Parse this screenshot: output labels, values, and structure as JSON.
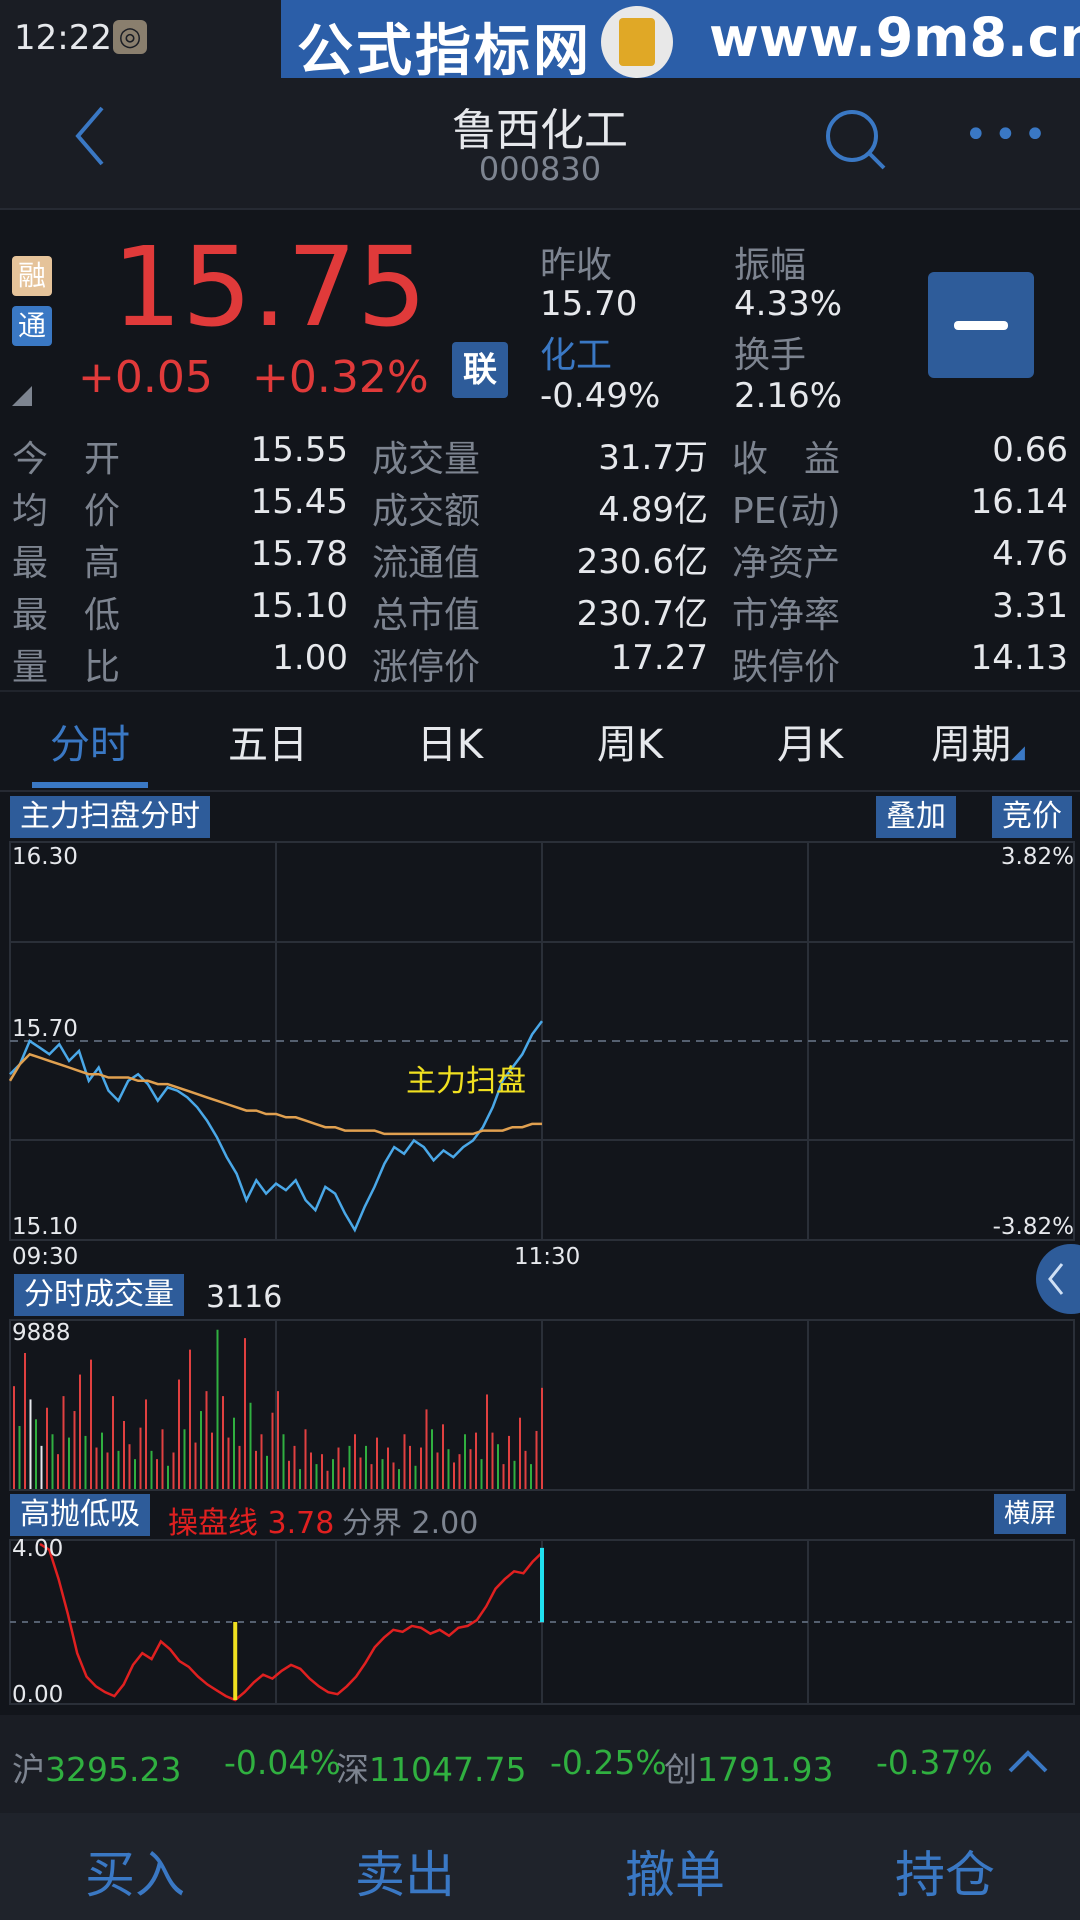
{
  "status": {
    "time": "12:22"
  },
  "banner": {
    "left_text": "公式指标网",
    "right_text": "www.9m8.cn"
  },
  "header": {
    "title": "鲁西化工",
    "code": "000830"
  },
  "quote": {
    "tags": [
      "融",
      "通"
    ],
    "price": "15.75",
    "change": "+0.05",
    "change_pct": "+0.32%",
    "lian": "联",
    "prev_close_label": "昨收",
    "prev_close": "15.70",
    "amplitude_label": "振幅",
    "amplitude": "4.33%",
    "sector_label": "化工",
    "sector_pct": "-0.49%",
    "turnover_label": "换手",
    "turnover": "2.16%"
  },
  "stats": [
    {
      "l1": "今",
      "l2": "开",
      "v1": "15.55",
      "m": "成交量",
      "v2": "31.7万",
      "r1": "收",
      "r2": "益",
      "v3": "0.66"
    },
    {
      "l1": "均",
      "l2": "价",
      "v1": "15.45",
      "m": "成交额",
      "v2": "4.89亿",
      "r1": "PE(动)",
      "r2": "",
      "v3": "16.14"
    },
    {
      "l1": "最",
      "l2": "高",
      "v1": "15.78",
      "m": "流通值",
      "v2": "230.6亿",
      "r1": "净资产",
      "r2": "",
      "v3": "4.76"
    },
    {
      "l1": "最",
      "l2": "低",
      "v1": "15.10",
      "m": "总市值",
      "v2": "230.7亿",
      "r1": "市净率",
      "r2": "",
      "v3": "3.31"
    },
    {
      "l1": "量",
      "l2": "比",
      "v1": "1.00",
      "m": "涨停价",
      "v2": "17.27",
      "r1": "跌停价",
      "r2": "",
      "v3": "14.13"
    }
  ],
  "tabs": [
    "分时",
    "五日",
    "日K",
    "周K",
    "月K",
    "周期"
  ],
  "chart1": {
    "label": "主力扫盘分时",
    "btn_overlay": "叠加",
    "btn_auction": "竞价",
    "y_top": "16.30",
    "y_mid": "15.70",
    "y_bot": "15.10",
    "pct_top": "3.82%",
    "pct_bot": "-3.82%",
    "t_start": "09:30",
    "t_mid": "11:30",
    "annotation": "主力扫盘",
    "colors": {
      "price": "#4aa8e8",
      "avg": "#e0a050",
      "annotation": "#f0e020"
    }
  },
  "chart2": {
    "label": "分时成交量",
    "value": "3116",
    "y_top": "9888"
  },
  "chart3": {
    "label": "高抛低吸",
    "line_label": "操盘线",
    "line_value": "3.78",
    "div_label": "分界",
    "div_value": "2.00",
    "btn_landscape": "横屏",
    "y_top": "4.00",
    "y_bot": "0.00",
    "colors": {
      "line": "#e02020",
      "low_marker": "#f0e020",
      "high_marker": "#20e0f0"
    }
  },
  "indices": [
    {
      "name": "沪",
      "value": "3295.23",
      "pct": "-0.04%"
    },
    {
      "name": "深",
      "value": "11047.75",
      "pct": "-0.25%"
    },
    {
      "name": "创",
      "value": "1791.93",
      "pct": "-0.37%"
    }
  ],
  "bottom": [
    "买入",
    "卖出",
    "撤单",
    "持仓"
  ],
  "chart_data": [
    {
      "type": "line",
      "title": "主力扫盘分时",
      "ylim": [
        15.1,
        16.3
      ],
      "x_labels": [
        "09:30",
        "11:30"
      ],
      "series": [
        {
          "values": [
            15.6,
            15.63,
            15.7,
            15.68,
            15.66,
            15.69,
            15.64,
            15.67,
            15.58,
            15.62,
            15.55,
            15.52,
            15.58,
            15.6,
            15.57,
            15.52,
            15.56,
            15.55,
            15.53,
            15.5,
            15.46,
            15.41,
            15.35,
            15.3,
            15.22,
            15.28,
            15.24,
            15.27,
            15.25,
            15.28,
            15.22,
            15.19,
            15.26,
            15.24,
            15.18,
            15.13,
            15.2,
            15.26,
            15.33,
            15.38,
            15.36,
            15.4,
            15.38,
            15.34,
            15.37,
            15.35,
            15.38,
            15.4,
            15.44,
            15.5,
            15.58,
            15.62,
            15.66,
            15.72,
            15.76
          ]
        },
        {
          "values": [
            15.58,
            15.63,
            15.66,
            15.65,
            15.64,
            15.63,
            15.62,
            15.61,
            15.6,
            15.6,
            15.59,
            15.59,
            15.59,
            15.58,
            15.58,
            15.57,
            15.57,
            15.56,
            15.55,
            15.54,
            15.53,
            15.52,
            15.51,
            15.5,
            15.49,
            15.49,
            15.48,
            15.48,
            15.47,
            15.47,
            15.46,
            15.45,
            15.44,
            15.44,
            15.43,
            15.43,
            15.43,
            15.43,
            15.42,
            15.42,
            15.42,
            15.42,
            15.42,
            15.42,
            15.42,
            15.42,
            15.42,
            15.42,
            15.43,
            15.43,
            15.43,
            15.44,
            15.44,
            15.45,
            15.45
          ]
        }
      ]
    },
    {
      "type": "bar",
      "title": "分时成交量",
      "ylim": [
        0,
        9888
      ],
      "values": [
        6200,
        3800,
        8200,
        5400,
        4200,
        2600,
        4900,
        3300,
        2100,
        5600,
        3100,
        4700,
        6900,
        3200,
        7800,
        2500,
        3400,
        2200,
        5600,
        2300,
        4100,
        2700,
        1800,
        3700,
        5400,
        2300,
        1800,
        3600,
        1400,
        2200,
        6600,
        3600,
        8400,
        2800,
        4700,
        5900,
        3400,
        9600,
        5600,
        3100,
        4300,
        2600,
        9100,
        5200,
        2300,
        3300,
        2000,
        4600,
        5900,
        3300,
        1700,
        2600,
        1200,
        3600,
        2200,
        1500,
        2100,
        1100,
        1800,
        2500,
        1300,
        2600,
        3300,
        1900,
        2600,
        1500,
        3100,
        1800,
        2500,
        1600,
        1200,
        3300,
        2600,
        1400,
        2500,
        4800,
        3600,
        2200,
        3900,
        2400,
        1600,
        2100,
        3300,
        2400,
        3400,
        1800,
        5700,
        3400,
        2700,
        1500,
        3200,
        1700,
        4300,
        2300,
        1500,
        3500,
        6100
      ],
      "colors_up": "#e04040",
      "colors_down": "#30b040"
    },
    {
      "type": "line",
      "title": "高抛低吸",
      "ylim": [
        0,
        4.0
      ],
      "series": [
        {
          "name": "操盘线",
          "values": [
            4.0,
            3.85,
            3.1,
            2.2,
            1.2,
            0.6,
            0.35,
            0.2,
            0.1,
            0.4,
            0.9,
            1.2,
            1.05,
            1.5,
            1.3,
            1.0,
            0.85,
            0.6,
            0.4,
            0.25,
            0.1,
            0.0,
            0.2,
            0.45,
            0.65,
            0.55,
            0.75,
            0.9,
            0.8,
            0.55,
            0.35,
            0.2,
            0.15,
            0.35,
            0.6,
            0.95,
            1.35,
            1.6,
            1.8,
            1.75,
            1.9,
            1.85,
            1.7,
            1.8,
            1.65,
            1.85,
            1.9,
            2.05,
            2.4,
            2.85,
            3.1,
            3.3,
            3.25,
            3.55,
            3.78
          ]
        },
        {
          "name": "分界",
          "values": [
            2.0
          ]
        }
      ]
    }
  ]
}
